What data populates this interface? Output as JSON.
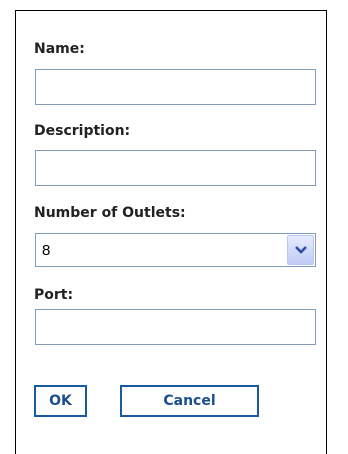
{
  "form": {
    "name_label": "Name:",
    "name_value": "",
    "description_label": "Description:",
    "description_value": "",
    "outlets_label": "Number of Outlets:",
    "outlets_selected": "8",
    "port_label": "Port:",
    "port_value": ""
  },
  "buttons": {
    "ok_label": "OK",
    "cancel_label": "Cancel"
  },
  "icons": {
    "dropdown": "chevron-down-icon"
  },
  "colors": {
    "field_border": "#7f9db9",
    "button_border": "#1a5a9e",
    "button_text": "#1a4f8a",
    "dropdown_bg": "#c1ccf7",
    "dropdown_arrow": "#2b4fa8"
  }
}
